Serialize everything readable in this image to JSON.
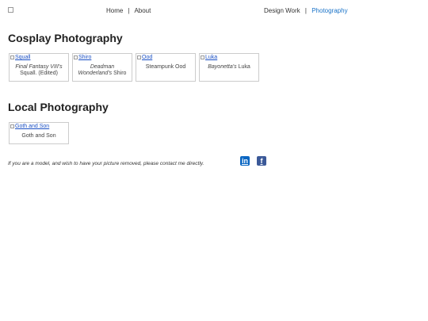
{
  "nav": {
    "left": [
      {
        "label": "Home"
      },
      {
        "label": "About"
      }
    ],
    "right": [
      {
        "label": "Design Work"
      },
      {
        "label": "Photography"
      }
    ],
    "separator": "|",
    "active_color": "#1a73c8"
  },
  "sections": [
    {
      "title": "Cosplay Photography",
      "items": [
        {
          "image_alt": "Squall",
          "caption_italic": "Final Fantasy VIII's",
          "caption_plain": "Squall. (Edited)"
        },
        {
          "image_alt": "Shiro",
          "caption_italic": "Deadman Wonderland's",
          "caption_plain": "Shiro"
        },
        {
          "image_alt": "Ood",
          "caption_italic": "",
          "caption_plain": "Steampunk Ood"
        },
        {
          "image_alt": "Luka",
          "caption_italic": "Bayonetta's",
          "caption_plain": "Luka"
        }
      ]
    },
    {
      "title": "Local Photography",
      "items": [
        {
          "image_alt": "Goth and Son",
          "caption_italic": "",
          "caption_plain": "Goth and Son"
        }
      ]
    }
  ],
  "footer": {
    "note": "If you are a model, and wish to have your picture removed, please contact me directly.",
    "social": [
      {
        "icon": "linkedin-icon",
        "glyph": "in",
        "color": "#0a66c2"
      },
      {
        "icon": "facebook-icon",
        "glyph": "f",
        "color": "#3b5998"
      }
    ]
  }
}
